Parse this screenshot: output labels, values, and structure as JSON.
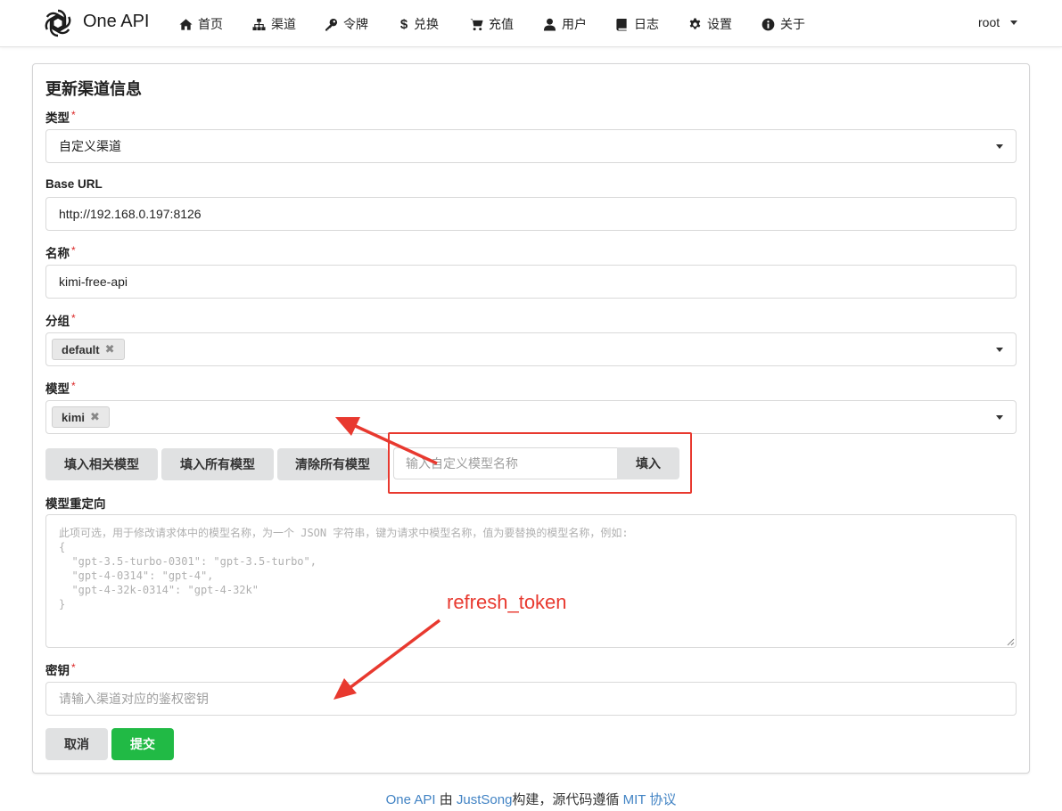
{
  "nav": {
    "brand": "One API",
    "items": [
      {
        "label": "首页",
        "icon": "home-icon"
      },
      {
        "label": "渠道",
        "icon": "sitemap-icon"
      },
      {
        "label": "令牌",
        "icon": "key-icon"
      },
      {
        "label": "兑换",
        "icon": "dollar-icon"
      },
      {
        "label": "充值",
        "icon": "cart-icon"
      },
      {
        "label": "用户",
        "icon": "user-icon"
      },
      {
        "label": "日志",
        "icon": "book-icon"
      },
      {
        "label": "设置",
        "icon": "gear-icon"
      },
      {
        "label": "关于",
        "icon": "info-icon"
      }
    ],
    "user": "root"
  },
  "form": {
    "title": "更新渠道信息",
    "required_mark": "*",
    "type": {
      "label": "类型",
      "value": "自定义渠道"
    },
    "base_url": {
      "label": "Base URL",
      "value": "http://192.168.0.197:8126"
    },
    "name": {
      "label": "名称",
      "value": "kimi-free-api"
    },
    "group": {
      "label": "分组",
      "chips": [
        "default"
      ]
    },
    "models": {
      "label": "模型",
      "chips": [
        "kimi"
      ]
    },
    "model_buttons": {
      "fill_related": "填入相关模型",
      "fill_all": "填入所有模型",
      "clear_all": "清除所有模型",
      "custom_placeholder": "输入自定义模型名称",
      "fill": "填入"
    },
    "model_mapping": {
      "label": "模型重定向",
      "placeholder": "此项可选，用于修改请求体中的模型名称，为一个 JSON 字符串，键为请求中模型名称，值为要替换的模型名称，例如:\n{\n  \"gpt-3.5-turbo-0301\": \"gpt-3.5-turbo\",\n  \"gpt-4-0314\": \"gpt-4\",\n  \"gpt-4-32k-0314\": \"gpt-4-32k\"\n}"
    },
    "key": {
      "label": "密钥",
      "placeholder": "请输入渠道对应的鉴权密钥"
    },
    "cancel": "取消",
    "submit": "提交"
  },
  "annotation": {
    "text": "refresh_token",
    "color": "#e8392f"
  },
  "footer": {
    "project": "One API",
    "by": "由",
    "author": "JustSong",
    "middle": "构建，源代码遵循",
    "license": "MIT 协议"
  },
  "colors": {
    "accent_green": "#21ba45",
    "link_blue": "#4183c4",
    "required_red": "#db2828"
  }
}
